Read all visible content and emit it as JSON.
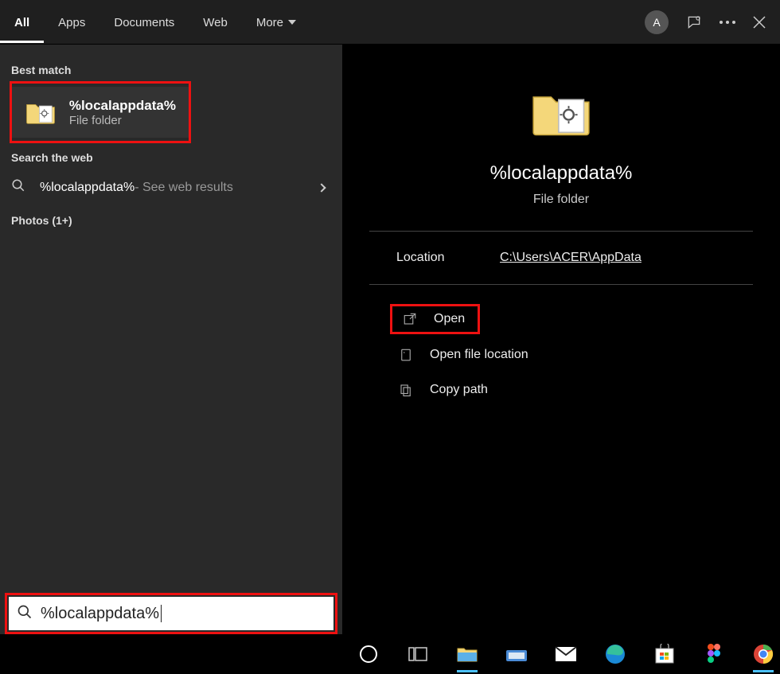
{
  "tabs": {
    "all": "All",
    "apps": "Apps",
    "documents": "Documents",
    "web": "Web",
    "more": "More"
  },
  "avatarLetter": "A",
  "sections": {
    "bestMatch": "Best match",
    "searchWeb": "Search the web",
    "photos": "Photos (1+)"
  },
  "bestMatch": {
    "title": "%localappdata%",
    "subtitle": "File folder"
  },
  "webResult": {
    "main": "%localappdata%",
    "suffix": " - See web results"
  },
  "detail": {
    "title": "%localappdata%",
    "subtitle": "File folder",
    "locationLabel": "Location",
    "locationValue": "C:\\Users\\ACER\\AppData"
  },
  "actions": {
    "open": "Open",
    "openFileLocation": "Open file location",
    "copyPath": "Copy path"
  },
  "search": {
    "value": "%localappdata%"
  }
}
